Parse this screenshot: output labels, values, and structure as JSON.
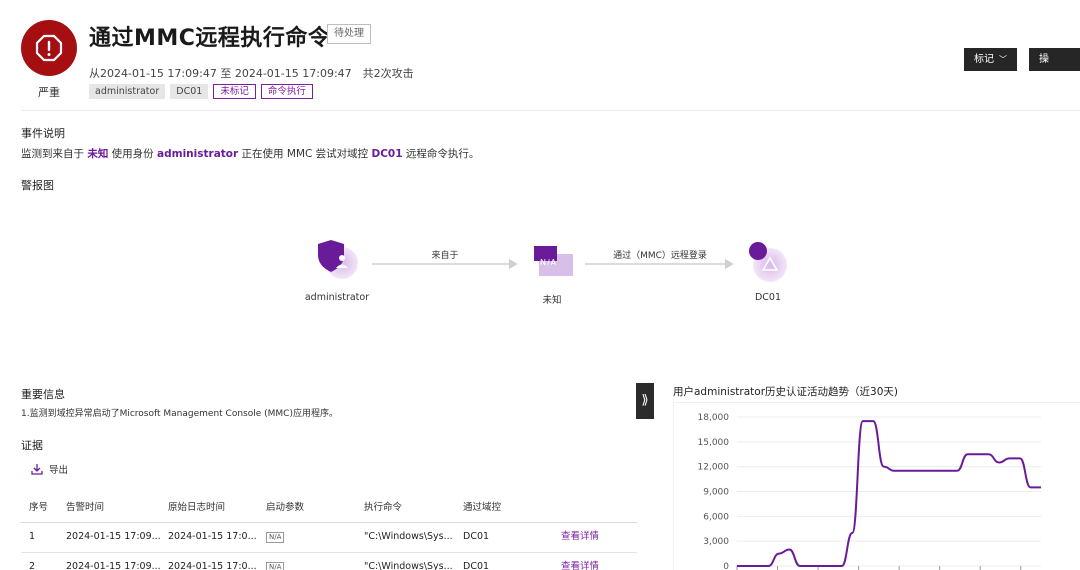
{
  "alert": {
    "severity_label": "严重",
    "title": "通过MMC远程执行命令",
    "status": "待处理",
    "time_range": "从2024-01-15 17:09:47 至 2024-01-15 17:09:47　共2次攻击",
    "tags": [
      {
        "label": "administrator",
        "style": "grey"
      },
      {
        "label": "DC01",
        "style": "grey"
      },
      {
        "label": "未标记",
        "style": "purple"
      },
      {
        "label": "命令执行",
        "style": "purple"
      }
    ]
  },
  "actions": {
    "mark_label": "标记",
    "operate_label": "操作",
    "chevron": "﹀"
  },
  "event": {
    "section_title": "事件说明",
    "desc_prefix": "监测到来自于 ",
    "desc_source": "未知",
    "desc_mid1": " 使用身份 ",
    "desc_identity": "administrator",
    "desc_mid2": " 正在使用 MMC 尝试对域控 ",
    "desc_target": "DC01",
    "desc_suffix": " 远程命令执行。"
  },
  "graph": {
    "section_title": "警报图",
    "nodes": [
      {
        "label": "administrator",
        "icon": "user-shield-icon"
      },
      {
        "label": "未知",
        "icon": "unknown-host-icon",
        "badge": "N/A"
      },
      {
        "label": "DC01",
        "icon": "domain-controller-icon"
      }
    ],
    "edges": [
      {
        "label": "来自于"
      },
      {
        "label": "通过（MMC）远程登录"
      }
    ]
  },
  "important": {
    "section_title": "重要信息",
    "text": "1.监测到域控异常启动了Microsoft Management Console (MMC)应用程序。"
  },
  "evidence": {
    "section_title": "证据",
    "export_label": "导出",
    "columns": [
      "序号",
      "告警时间",
      "原始日志时间",
      "启动参数",
      "执行命令",
      "通过域控",
      ""
    ],
    "rows": [
      {
        "no": "1",
        "alert_time": "2024-01-15 17:09...",
        "log_time": "2024-01-15 17:0...",
        "params": "N/A",
        "command": "\"C:\\Windows\\Sys...",
        "dc": "DC01",
        "action": "查看详情"
      },
      {
        "no": "2",
        "alert_time": "2024-01-15 17:09...",
        "log_time": "2024-01-15 17:0...",
        "params": "N/A",
        "command": "\"C:\\Windows\\Sys...",
        "dc": "DC01",
        "action": "查看详情"
      }
    ]
  },
  "trend": {
    "title": "用户administrator历史认证活动趋势（近30天)",
    "collapse_glyph": "⟫"
  },
  "colors": {
    "severity": "#a50f12",
    "accent": "#7a1fa2",
    "line": "#6a1b9a"
  },
  "chart_data": {
    "type": "line",
    "title": "用户administrator历史认证活动趋势（近30天)",
    "xlabel": "",
    "ylabel": "",
    "ylim": [
      0,
      18000
    ],
    "y_ticks": [
      "18,000",
      "15,000",
      "12,000",
      "9,000",
      "6,000",
      "3,000",
      "0"
    ],
    "grid": true,
    "series": [
      {
        "x": [
          1,
          2,
          3,
          4,
          5,
          6,
          7,
          8,
          9,
          10,
          11,
          12,
          13,
          14,
          15,
          16,
          17,
          18,
          19,
          20,
          21,
          22,
          23,
          24,
          25,
          26,
          27,
          28,
          29,
          30
        ],
        "values": [
          0,
          0,
          0,
          0,
          1500,
          2000,
          0,
          0,
          0,
          0,
          0,
          4000,
          17500,
          17500,
          12000,
          11500,
          11500,
          11500,
          11500,
          11500,
          11500,
          11500,
          13500,
          13500,
          13500,
          12500,
          13000,
          13000,
          9500,
          9500
        ]
      }
    ]
  }
}
